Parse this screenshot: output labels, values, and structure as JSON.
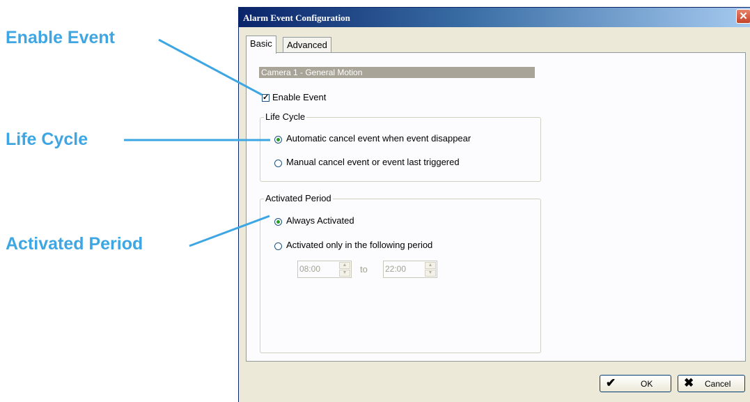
{
  "callouts": {
    "enable_event": "Enable Event",
    "life_cycle": "Life Cycle",
    "activated_period": "Activated Period"
  },
  "dialog": {
    "title": "Alarm Event Configuration",
    "close_symbol": "✕",
    "tabs": [
      {
        "label": "Basic",
        "active": true
      },
      {
        "label": "Advanced",
        "active": false
      }
    ],
    "section_header": "Camera 1 - General Motion",
    "enable_event": {
      "label": "Enable Event",
      "checked": true
    },
    "life_cycle": {
      "legend": "Life Cycle",
      "options": [
        {
          "label": "Automatic cancel event when event disappear",
          "selected": true
        },
        {
          "label": "Manual cancel event or event last triggered",
          "selected": false
        }
      ]
    },
    "activated_period": {
      "legend": "Activated Period",
      "options": [
        {
          "label": "Always Activated",
          "selected": true
        },
        {
          "label": "Activated only in the following period",
          "selected": false
        }
      ],
      "start_time": "08:00",
      "to_label": "to",
      "end_time": "22:00"
    },
    "buttons": {
      "ok": "OK",
      "cancel": "Cancel"
    }
  },
  "colors": {
    "callout": "#3da6e3",
    "dialog_bg": "#ece9d8",
    "section_bar": "#a9a498",
    "title_gradient_start": "#0a246a"
  },
  "icons": {
    "close": "close-icon",
    "ok": "checkmark-icon",
    "cancel": "x-icon",
    "spin_up": "spin-up-icon",
    "spin_down": "spin-down-icon"
  }
}
